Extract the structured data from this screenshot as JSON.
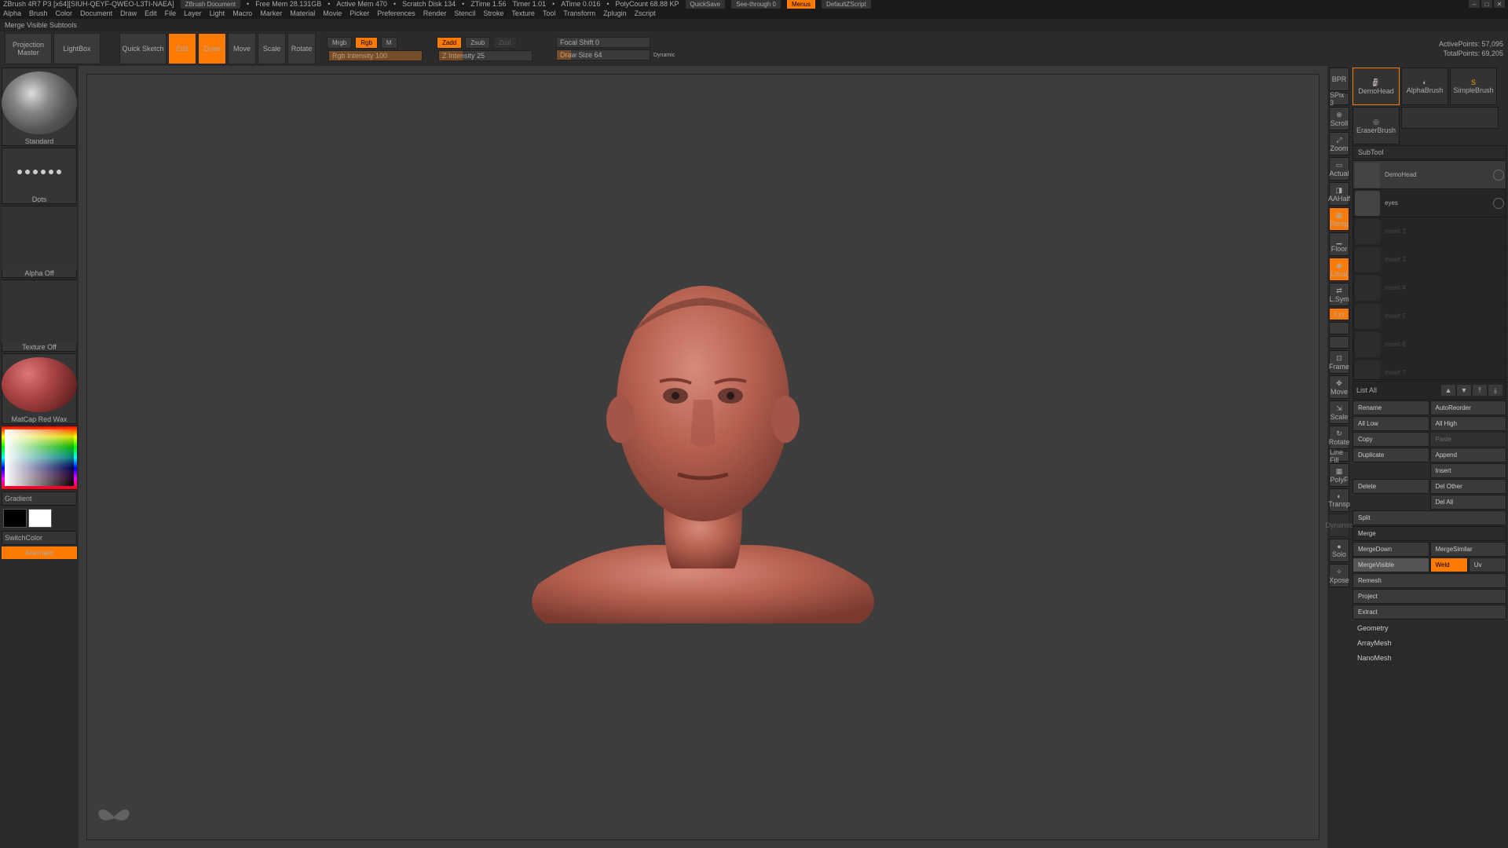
{
  "title": {
    "app": "ZBrush 4R7 P3 [x64][SIUH-QEYF-QWEO-L3TI-NAEA]",
    "doc": "ZBrush Document",
    "freemem": "Free Mem 28.131GB",
    "activemem": "Active Mem 470",
    "scratch": "Scratch Disk 134",
    "ztime": "ZTime 1.56",
    "timer": "Timer 1.01",
    "atime": "ATime 0.016",
    "polycount": "PolyCount 68.88 KP",
    "quicksave": "QuickSave",
    "seethrough": "See-through  0",
    "menus": "Menus",
    "script": "DefaultZScript"
  },
  "menubar": [
    "Alpha",
    "Brush",
    "Color",
    "Document",
    "Draw",
    "Edit",
    "File",
    "Layer",
    "Light",
    "Macro",
    "Marker",
    "Material",
    "Movie",
    "Picker",
    "Preferences",
    "Render",
    "Stencil",
    "Stroke",
    "Texture",
    "Tool",
    "Transform",
    "Zplugin",
    "Zscript"
  ],
  "status": "Merge Visible Subtools",
  "toolbar": {
    "projection": "Projection\nMaster",
    "lightbox": "LightBox",
    "quicksketch": "Quick\nSketch",
    "edit": "Edit",
    "draw": "Draw",
    "move": "Move",
    "scale": "Scale",
    "rotate": "Rotate",
    "mrgb": "Mrgb",
    "rgb": "Rgb",
    "m": "M",
    "rgbint": "Rgb Intensity 100",
    "zadd": "Zadd",
    "zsub": "Zsub",
    "zcut": "Zcut",
    "zint": "Z Intensity 25",
    "focal": "Focal Shift 0",
    "drawsize": "Draw Size 64",
    "dynamic": "Dynamic",
    "activepts": "ActivePoints: 57,095",
    "totalpts": "TotalPoints: 69,205"
  },
  "left": {
    "brush": "Standard",
    "stroke": "Dots",
    "alpha": "Alpha Off",
    "texture": "Texture Off",
    "material": "MatCap Red Wax",
    "gradient": "Gradient",
    "switch": "SwitchColor",
    "alternate": "Alternate"
  },
  "iconstrip": {
    "spix": "SPix 3",
    "bpr": "BPR",
    "scroll": "Scroll",
    "zoom": "Zoom",
    "actual": "Actual",
    "aahalf": "AAHalf",
    "persp": "Persp",
    "floor": "Floor",
    "local": "Local",
    "lsym": "L.Sym",
    "xyz": "Xyz",
    "frame": "Frame",
    "move": "Move",
    "scale": "Scale",
    "rotate": "Rotate",
    "linefill": "Line Fill",
    "polyf": "PolyF",
    "transp": "Transp",
    "dynamic": "Dynamic",
    "solo": "Solo",
    "xpose": "Xpose"
  },
  "brushes": {
    "demohead": "DemoHead",
    "alphabrush": "AlphaBrush",
    "simplebrush": "SimpleBrush",
    "eraserbrush": "EraserBrush"
  },
  "subtool": {
    "header": "SubTool",
    "items": [
      {
        "name": "DemoHead"
      },
      {
        "name": "eyes"
      },
      {
        "name": "Insert 3"
      },
      {
        "name": "Insert 3"
      },
      {
        "name": "Insert 4"
      },
      {
        "name": "Insert 5"
      },
      {
        "name": "Insert 6"
      },
      {
        "name": "Insert 7"
      }
    ],
    "listall": "List All",
    "rename": "Rename",
    "autoreorder": "AutoReorder",
    "alllow": "All Low",
    "allhigh": "All High",
    "copy": "Copy",
    "paste": "Paste",
    "duplicate": "Duplicate",
    "append": "Append",
    "insert": "Insert",
    "delete": "Delete",
    "delother": "Del Other",
    "delall": "Del All",
    "split": "Split",
    "merge": "Merge",
    "mergedown": "MergeDown",
    "mergesimilar": "MergeSimilar",
    "mergevisible": "MergeVisible",
    "weld": "Weld",
    "uv": "Uv",
    "remesh": "Remesh",
    "project": "Project",
    "extract": "Extract",
    "geometry": "Geometry",
    "arraymesh": "ArrayMesh",
    "nanomesh": "NanoMesh"
  }
}
